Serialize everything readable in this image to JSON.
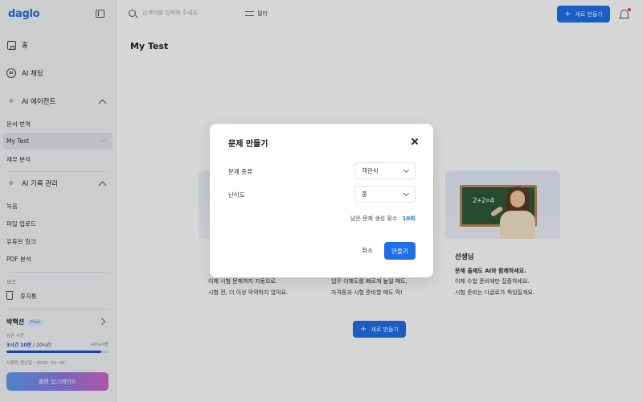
{
  "sidebar": {
    "logo": "daglo",
    "home": "홈",
    "ai_chat": "AI 채팅",
    "ai_agent": {
      "label": "AI 에이전트",
      "items": [
        "문서 번역",
        "My Test",
        "재무 분석"
      ],
      "active": "My Test"
    },
    "ai_records": {
      "label": "AI 기록 관리",
      "items": [
        "녹음",
        "파일 업로드",
        "유튜브 링크",
        "PDF 분석"
      ]
    },
    "board_section": "보드",
    "trash": "휴지통",
    "user": {
      "name": "박핵션",
      "plan": "Free",
      "remaining_label": "남은 시간",
      "remaining_used": "3시간 10분",
      "remaining_total": "/ 10시간",
      "percent_text": "40%사용",
      "usage_fraction": 0.93,
      "reset_text": "사용량 갱신일 : 0000. 00. 00."
    },
    "upgrade": "플랜 업그레이드"
  },
  "topbar": {
    "search_placeholder": "검색어를 입력해 주세요",
    "filter": "필터",
    "new_button": "새로 만들기"
  },
  "main": {
    "page_title": "My Test",
    "cards": [
      {
        "title": "",
        "bold_line": "",
        "lines": [
          "이제 시험 문제까지 자동으로.",
          "시험 전, 더 이상 막막하지 않아요."
        ]
      },
      {
        "title": "",
        "bold_line": "",
        "lines": [
          "업무 이해도를 빠르게 높일 때도,",
          "자격증과 시험 준비할 때도 딱!"
        ]
      },
      {
        "title": "선생님",
        "bold_line": "문제 출제도 AI와 함께하세요.",
        "lines": [
          "이제 수업 준비에만 집중하세요.",
          "시험 준비는 다글로가 책임질게요."
        ],
        "board_text": "2+2=4"
      }
    ],
    "new_button": "새로 만들기"
  },
  "modal": {
    "title": "문제 만들기",
    "type_label": "문제 종류",
    "type_value": "객관식",
    "difficulty_label": "난이도",
    "difficulty_value": "중",
    "remaining_text": "남은 문제 생성 횟수",
    "remaining_count": "10회",
    "cancel": "취소",
    "confirm": "만들기"
  },
  "colors": {
    "accent": "#1f6feb",
    "usage_bar": "#1f4fcf",
    "notification_dot": "#ef4444"
  },
  "icons": [
    "collapse-sidebar-icon",
    "home-icon",
    "ai-chat-icon",
    "sparkle-icon",
    "chevron-up-icon",
    "more-icon",
    "trash-icon",
    "chevron-right-icon",
    "search-icon",
    "filter-icon",
    "plus-icon",
    "bell-icon",
    "close-icon",
    "chevron-down-icon"
  ]
}
